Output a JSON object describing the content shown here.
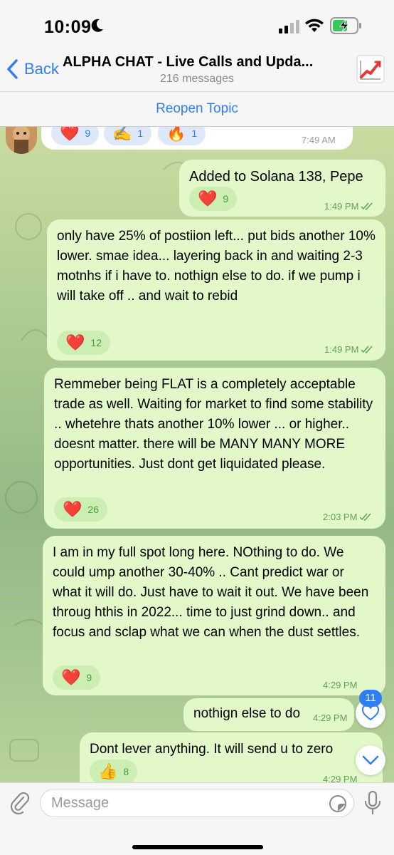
{
  "status_bar": {
    "time": "10:09",
    "icons": [
      "moon-icon",
      "cellular-signal-icon",
      "wifi-icon",
      "battery-charging-icon"
    ]
  },
  "header": {
    "back_label": "Back",
    "title": "ALPHA CHAT - Live Calls and Upda...",
    "subtitle": "216 messages",
    "topic_icon": "chart-increasing-icon"
  },
  "reopen_label": "Reopen Topic",
  "messages": [
    {
      "direction": "incoming",
      "text": "",
      "time": "7:49 AM",
      "reactions": [
        {
          "emoji": "❤️",
          "count": "9"
        },
        {
          "emoji": "✍️",
          "count": "1"
        },
        {
          "emoji": "🔥",
          "count": "1"
        }
      ]
    },
    {
      "direction": "outgoing",
      "text": "Added to Solana 138, Pepe",
      "time": "1:49 PM",
      "reactions": [
        {
          "emoji": "❤️",
          "count": "9"
        }
      ]
    },
    {
      "direction": "outgoing",
      "text": "only have 25% of postiion left... put bids another 10% lower. smae idea... layering back in and waiting 2-3 motnhs if i have to. nothign else to do. if we pump i will take off .. and wait to rebid",
      "time": "1:49 PM",
      "reactions": [
        {
          "emoji": "❤️",
          "count": "12"
        }
      ]
    },
    {
      "direction": "outgoing",
      "text": "Remmeber being FLAT is a completely acceptable trade as well. Waiting for market to find some stability .. whetehre thats another 10% lower ... or higher.. doesnt matter. there will be MANY MANY MORE opportunities. Just dont get liquidated please.",
      "time": "2:03 PM",
      "reactions": [
        {
          "emoji": "❤️",
          "count": "26"
        }
      ]
    },
    {
      "direction": "outgoing",
      "text": "I am in my full spot long here. NOthing to do. We could ump another 30-40% .. Cant predict war or what it will do. Just have to wait it out. We have been throug hthis in 2022... time to just grind down.. and focus and sclap what we can when the dust settles.",
      "time": "4:29 PM",
      "reactions": [
        {
          "emoji": "❤️",
          "count": "9"
        }
      ]
    },
    {
      "direction": "outgoing",
      "text": "nothign else to do",
      "time": "4:29 PM",
      "reactions": []
    },
    {
      "direction": "outgoing",
      "text": "Dont lever anything. It will send u to zero",
      "time": "4:29 PM",
      "reactions": [
        {
          "emoji": "👍",
          "count": "8"
        }
      ]
    }
  ],
  "floating": {
    "reactions_badge": "11",
    "heart_icon": "heart-outline-icon",
    "scroll_icon": "chevron-down-icon"
  },
  "composer": {
    "placeholder": "Message",
    "attach_icon": "paperclip-icon",
    "sticker_icon": "sticker-icon",
    "mic_icon": "microphone-icon"
  },
  "colors": {
    "accent": "#2f7ef5",
    "outgoing_bubble": "#e2f8c8",
    "incoming_bubble": "#ffffff",
    "reaction_out": "#cdeeb2",
    "reaction_in": "#dde9f8",
    "time_out": "#5fa452"
  }
}
